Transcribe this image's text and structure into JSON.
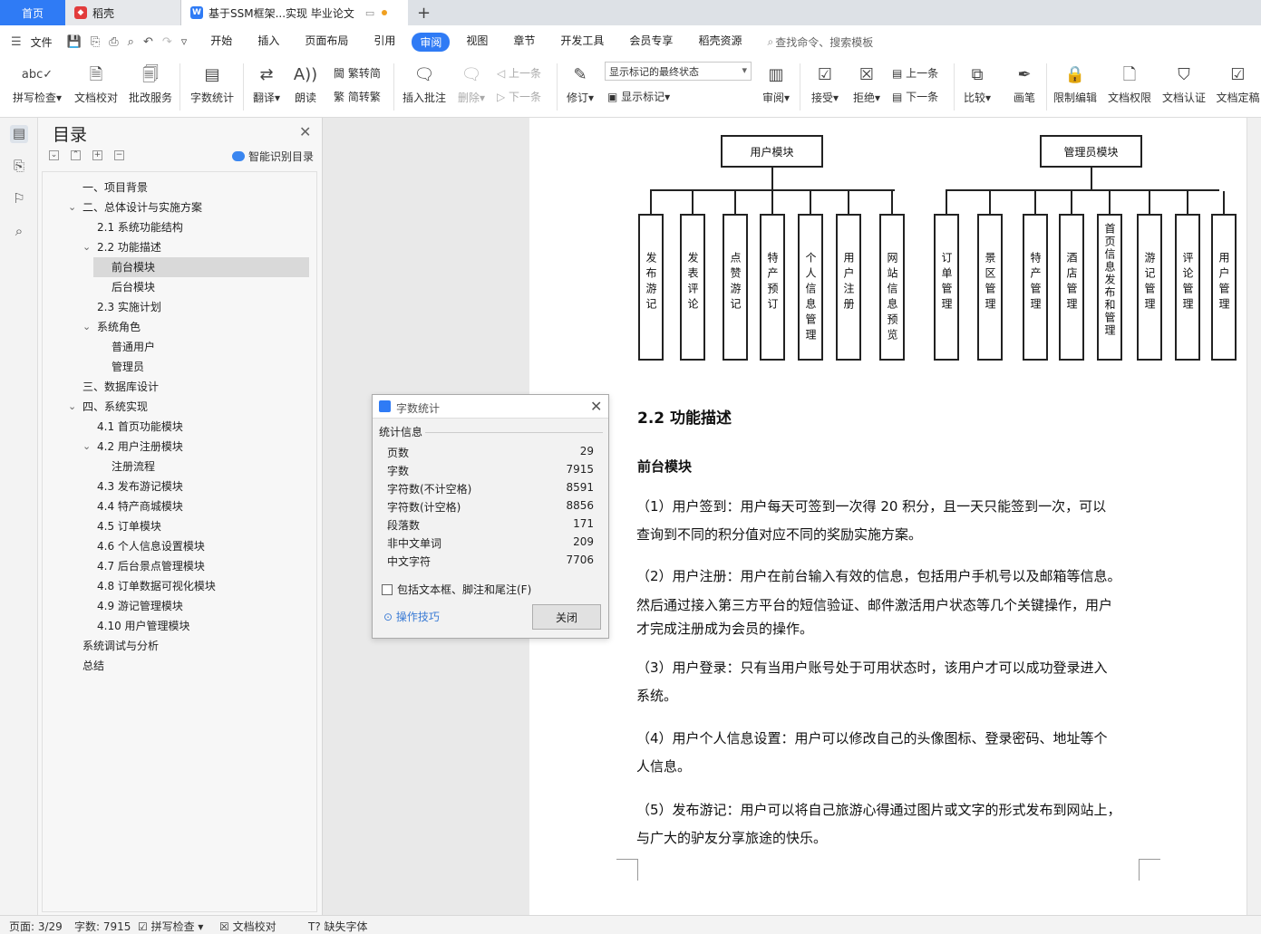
{
  "tabs": {
    "home": "首页",
    "daoke": "稻壳",
    "doc": "基于SSM框架...实现 毕业论文",
    "new": "+"
  },
  "menu": {
    "file": "文件",
    "items": [
      "开始",
      "插入",
      "页面布局",
      "引用",
      "审阅",
      "视图",
      "章节",
      "开发工具",
      "会员专享",
      "稻壳资源"
    ],
    "active_index": 4,
    "search": "查找命令、搜索模板"
  },
  "ribbon": {
    "spell": "拼写检查",
    "proof": "文档校对",
    "batch": "批改服务",
    "wordcount": "字数统计",
    "translate": "翻译",
    "read": "朗读",
    "trad": "繁转简",
    "simp": "简转繁",
    "insert_comment": "插入批注",
    "delete": "删除",
    "prev_c": "上一条",
    "next_c": "下一条",
    "revise": "修订",
    "markup_state": "显示标记的最终状态",
    "show_markup": "显示标记",
    "review": "审阅",
    "accept": "接受",
    "reject": "拒绝",
    "prev": "上一条",
    "next": "下一条",
    "compare": "比较",
    "pen": "画笔",
    "restrict": "限制编辑",
    "perm": "文档权限",
    "cert": "文档认证",
    "final": "文档定稿"
  },
  "nav": {
    "title": "目录",
    "smart": "智能识别目录",
    "toc": [
      {
        "t": "一、项目背景",
        "lvl": 1
      },
      {
        "t": "二、总体设计与实施方案",
        "lvl": 1,
        "exp": true
      },
      {
        "t": "2.1  系统功能结构",
        "lvl": 2
      },
      {
        "t": "2.2  功能描述",
        "lvl": 2,
        "exp": true
      },
      {
        "t": "前台模块",
        "lvl": 3,
        "sel": true
      },
      {
        "t": "后台模块",
        "lvl": 3
      },
      {
        "t": "2.3  实施计划",
        "lvl": 2
      },
      {
        "t": "系统角色",
        "lvl": 2,
        "exp": true
      },
      {
        "t": "普通用户",
        "lvl": 3
      },
      {
        "t": "管理员",
        "lvl": 3
      },
      {
        "t": "三、数据库设计",
        "lvl": 1
      },
      {
        "t": "四、系统实现",
        "lvl": 1,
        "exp": true
      },
      {
        "t": "4.1  首页功能模块",
        "lvl": 2
      },
      {
        "t": "4.2  用户注册模块",
        "lvl": 2,
        "exp": true
      },
      {
        "t": "注册流程",
        "lvl": 3
      },
      {
        "t": "4.3  发布游记模块",
        "lvl": 2
      },
      {
        "t": "4.4  特产商城模块",
        "lvl": 2
      },
      {
        "t": "4.5  订单模块",
        "lvl": 2
      },
      {
        "t": "4.6  个人信息设置模块",
        "lvl": 2
      },
      {
        "t": "4.7  后台景点管理模块",
        "lvl": 2
      },
      {
        "t": "4.8  订单数据可视化模块",
        "lvl": 2
      },
      {
        "t": "4.9  游记管理模块",
        "lvl": 2
      },
      {
        "t": "4.10  用户管理模块",
        "lvl": 2
      },
      {
        "t": "系统调试与分析",
        "lvl": 1
      },
      {
        "t": "总结",
        "lvl": 1
      }
    ]
  },
  "diagram": {
    "user_module": "用户模块",
    "admin_module": "管理员模块",
    "user_items": [
      "发布游记",
      "发表评论",
      "点赞游记",
      "特产预订",
      "个人信息管理",
      "用户注册",
      "网站信息预览"
    ],
    "admin_items": [
      "订单管理",
      "景区管理",
      "特产管理",
      "酒店管理",
      "首页信息发布和管理",
      "游记管理",
      "评论管理",
      "用户管理"
    ]
  },
  "doc": {
    "h22": "2.2  功能描述",
    "front": "前台模块",
    "p1a": "（1）用户签到：用户每天可签到一次得 20 积分，且一天只能签到一次，可以",
    "p1b": "查询到不同的积分值对应不同的奖励实施方案。",
    "p2a": "（2）用户注册：用户在前台输入有效的信息，包括用户手机号以及邮箱等信息。",
    "p2b": "然后通过接入第三方平台的短信验证、邮件激活用户状态等几个关键操作，用户",
    "p2c": "才完成注册成为会员的操作。",
    "p3a": "（3）用户登录：只有当用户账号处于可用状态时，该用户才可以成功登录进入",
    "p3b": "系统。",
    "p4a": "（4）用户个人信息设置：用户可以修改自己的头像图标、登录密码、地址等个",
    "p4b": "人信息。",
    "p5a": "（5）发布游记：用户可以将自己旅游心得通过图片或文字的形式发布到网站上，",
    "p5b": "与广大的驴友分享旅途的快乐。"
  },
  "dialog": {
    "title": "字数统计",
    "section": "统计信息",
    "rows": [
      {
        "k": "页数",
        "v": "29"
      },
      {
        "k": "字数",
        "v": "7915"
      },
      {
        "k": "字符数(不计空格)",
        "v": "8591"
      },
      {
        "k": "字符数(计空格)",
        "v": "8856"
      },
      {
        "k": "段落数",
        "v": "171"
      },
      {
        "k": "非中文单词",
        "v": "209"
      },
      {
        "k": "中文字符",
        "v": "7706"
      }
    ],
    "checkbox": "包括文本框、脚注和尾注(F)",
    "tips": "操作技巧",
    "close": "关闭"
  },
  "status": {
    "page": "页面: 3/29",
    "words": "字数: 7915",
    "spell": "拼写检查",
    "proof": "文档校对",
    "font": "缺失字体"
  }
}
